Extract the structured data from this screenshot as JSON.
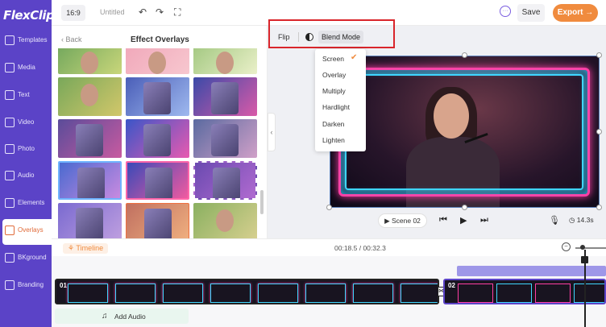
{
  "app": {
    "logo_text": "FlexClip"
  },
  "nav": {
    "items": [
      {
        "label": "Templates",
        "icon": "templates-icon"
      },
      {
        "label": "Media",
        "icon": "media-icon"
      },
      {
        "label": "Text",
        "icon": "text-icon"
      },
      {
        "label": "Video",
        "icon": "video-icon"
      },
      {
        "label": "Photo",
        "icon": "photo-icon"
      },
      {
        "label": "Audio",
        "icon": "audio-icon"
      },
      {
        "label": "Elements",
        "icon": "elements-icon"
      },
      {
        "label": "Overlays",
        "icon": "overlays-icon",
        "active": true
      },
      {
        "label": "BKground",
        "icon": "background-icon"
      },
      {
        "label": "Branding",
        "icon": "branding-icon"
      }
    ]
  },
  "topbar": {
    "aspect_ratio": "16:9",
    "project_name": "Untitled",
    "undo_icon": "↶",
    "redo_icon": "↷",
    "fullscreen_icon": "⛶",
    "help_icon": "···",
    "save_label": "Save",
    "export_label": "Export →"
  },
  "panel": {
    "back_label": "‹ Back",
    "title": "Effect Overlays",
    "collapse_icon": "‹"
  },
  "preview": {
    "toolbar": {
      "flip_label": "Flip",
      "blend_label": "Blend Mode"
    },
    "blend_menu": {
      "options": [
        "Screen",
        "Overlay",
        "Multiply",
        "Hardlight",
        "Darken",
        "Lighten"
      ],
      "selected": "Screen",
      "check_icon": "✔"
    },
    "controls": {
      "scene_label": "▶ Scene  02",
      "prev_icon": "⏮",
      "play_icon": "▶",
      "next_icon": "⏭",
      "mic_icon": "🎙",
      "duration": "◷ 14.3s"
    }
  },
  "timeline": {
    "label": "⚘ Timeline",
    "time": "00:18.5 / 00:32.3",
    "zoom_minus": "−",
    "clips": [
      {
        "number": "01"
      },
      {
        "number": "02"
      }
    ],
    "transition_icon": "⋈",
    "add_audio_label": "Add Audio",
    "add_audio_icon": "♫"
  },
  "colors": {
    "brand_purple": "#5b43c7",
    "accent_orange": "#f08b3e",
    "highlight_red": "#d9252b"
  }
}
